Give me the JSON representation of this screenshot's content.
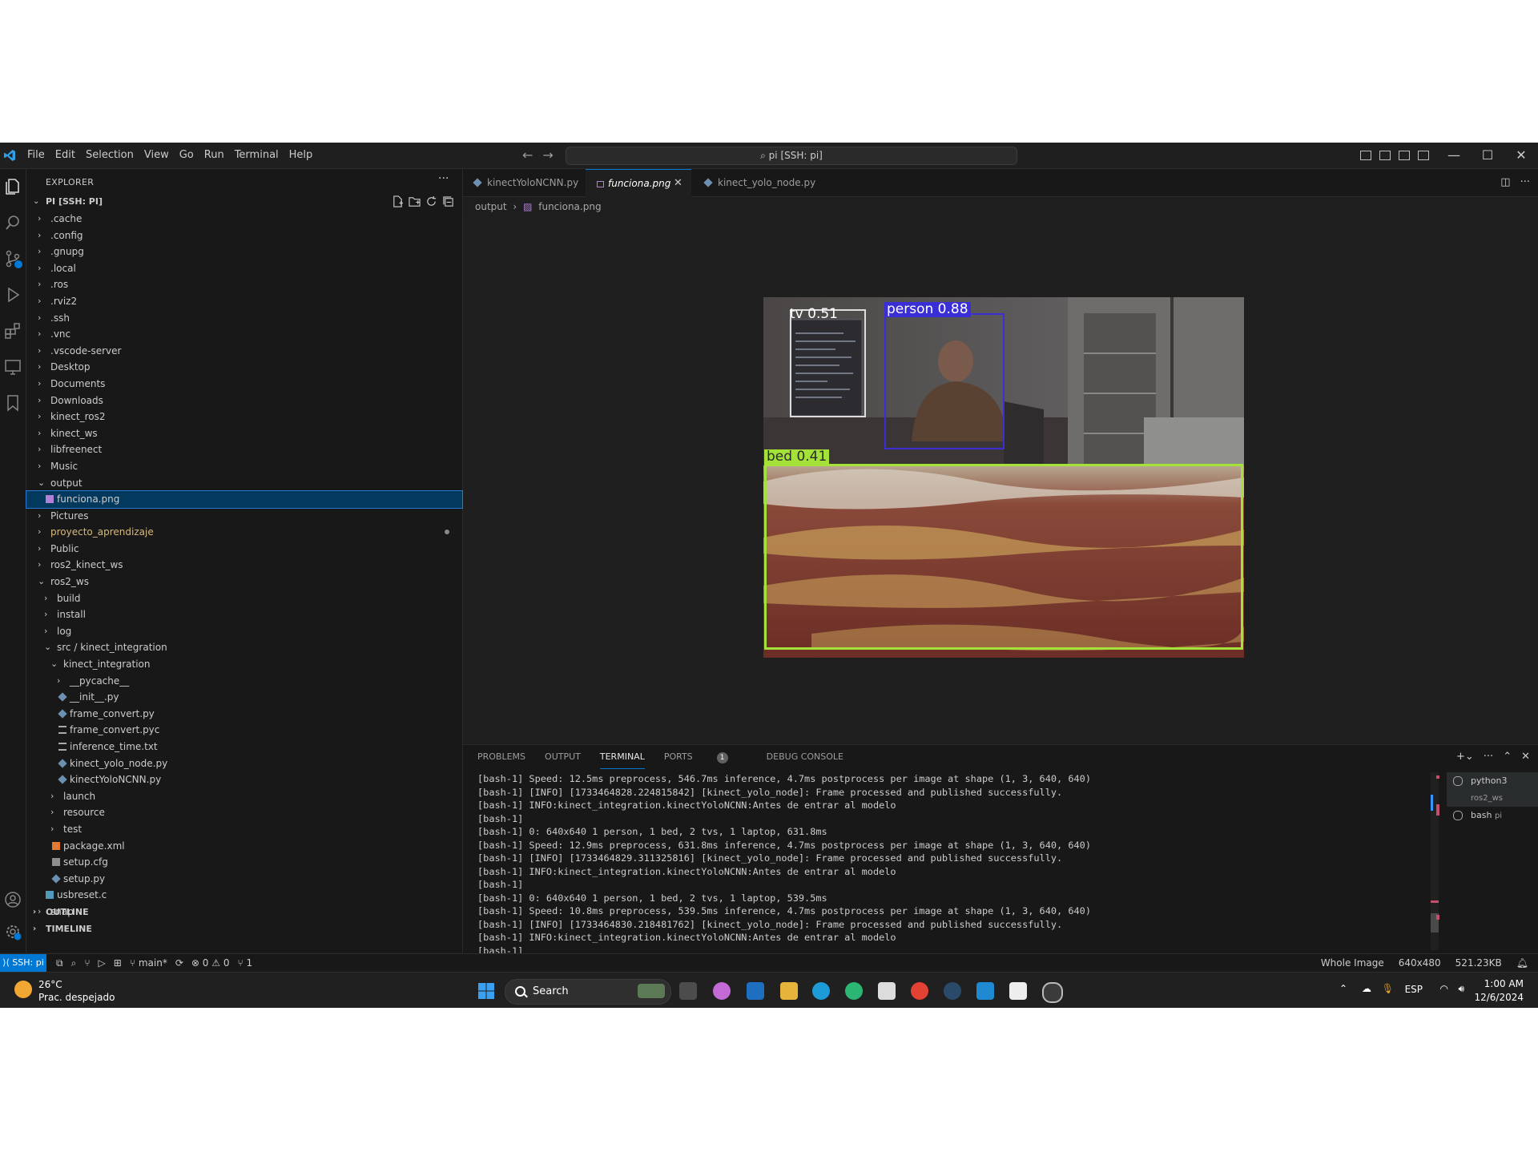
{
  "titlebar": {
    "menu": [
      "File",
      "Edit",
      "Selection",
      "View",
      "Go",
      "Run",
      "Terminal",
      "Help"
    ],
    "command_center": "pi [SSH: pi]",
    "back_icon": "arrow-left-icon",
    "forward_icon": "arrow-right-icon"
  },
  "sidebar": {
    "title": "EXPLORER",
    "root": "PI [SSH: PI]",
    "tree": [
      {
        "name": ".cache",
        "depth": 0,
        "kind": "folder",
        "open": false
      },
      {
        "name": ".config",
        "depth": 0,
        "kind": "folder",
        "open": false
      },
      {
        "name": ".gnupg",
        "depth": 0,
        "kind": "folder",
        "open": false
      },
      {
        "name": ".local",
        "depth": 0,
        "kind": "folder",
        "open": false
      },
      {
        "name": ".ros",
        "depth": 0,
        "kind": "folder",
        "open": false
      },
      {
        "name": ".rviz2",
        "depth": 0,
        "kind": "folder",
        "open": false
      },
      {
        "name": ".ssh",
        "depth": 0,
        "kind": "folder",
        "open": false
      },
      {
        "name": ".vnc",
        "depth": 0,
        "kind": "folder",
        "open": false
      },
      {
        "name": ".vscode-server",
        "depth": 0,
        "kind": "folder",
        "open": false
      },
      {
        "name": "Desktop",
        "depth": 0,
        "kind": "folder",
        "open": false
      },
      {
        "name": "Documents",
        "depth": 0,
        "kind": "folder",
        "open": false
      },
      {
        "name": "Downloads",
        "depth": 0,
        "kind": "folder",
        "open": false
      },
      {
        "name": "kinect_ros2",
        "depth": 0,
        "kind": "folder",
        "open": false
      },
      {
        "name": "kinect_ws",
        "depth": 0,
        "kind": "folder",
        "open": false
      },
      {
        "name": "libfreenect",
        "depth": 0,
        "kind": "folder",
        "open": false
      },
      {
        "name": "Music",
        "depth": 0,
        "kind": "folder",
        "open": false
      },
      {
        "name": "output",
        "depth": 0,
        "kind": "folder",
        "open": true
      },
      {
        "name": "funciona.png",
        "depth": 1,
        "kind": "png",
        "selected": true
      },
      {
        "name": "Pictures",
        "depth": 0,
        "kind": "folder",
        "open": false
      },
      {
        "name": "proyecto_aprendizaje",
        "depth": 0,
        "kind": "folder",
        "open": false,
        "modified": true
      },
      {
        "name": "Public",
        "depth": 0,
        "kind": "folder",
        "open": false
      },
      {
        "name": "ros2_kinect_ws",
        "depth": 0,
        "kind": "folder",
        "open": false
      },
      {
        "name": "ros2_ws",
        "depth": 0,
        "kind": "folder",
        "open": true
      },
      {
        "name": "build",
        "depth": 1,
        "kind": "folder",
        "open": false
      },
      {
        "name": "install",
        "depth": 1,
        "kind": "folder",
        "open": false
      },
      {
        "name": "log",
        "depth": 1,
        "kind": "folder",
        "open": false
      },
      {
        "name": "src / kinect_integration",
        "depth": 1,
        "kind": "folder",
        "open": true
      },
      {
        "name": "kinect_integration",
        "depth": 2,
        "kind": "folder",
        "open": true
      },
      {
        "name": "__pycache__",
        "depth": 3,
        "kind": "folder",
        "open": false
      },
      {
        "name": "__init__.py",
        "depth": 3,
        "kind": "py"
      },
      {
        "name": "frame_convert.py",
        "depth": 3,
        "kind": "py"
      },
      {
        "name": "frame_convert.pyc",
        "depth": 3,
        "kind": "txt"
      },
      {
        "name": "inference_time.txt",
        "depth": 3,
        "kind": "txt"
      },
      {
        "name": "kinect_yolo_node.py",
        "depth": 3,
        "kind": "py"
      },
      {
        "name": "kinectYoloNCNN.py",
        "depth": 3,
        "kind": "py"
      },
      {
        "name": "launch",
        "depth": 2,
        "kind": "folder",
        "open": false
      },
      {
        "name": "resource",
        "depth": 2,
        "kind": "folder",
        "open": false
      },
      {
        "name": "test",
        "depth": 2,
        "kind": "folder",
        "open": false
      },
      {
        "name": "package.xml",
        "depth": 2,
        "kind": "xml"
      },
      {
        "name": "setup.cfg",
        "depth": 2,
        "kind": "cfg"
      },
      {
        "name": "setup.py",
        "depth": 2,
        "kind": "py"
      },
      {
        "name": "usbreset.c",
        "depth": 1,
        "kind": "c"
      },
      {
        "name": "snap",
        "depth": 0,
        "kind": "folder",
        "open": false
      }
    ],
    "outline": "OUTLINE",
    "timeline": "TIMELINE"
  },
  "editor": {
    "tabs": [
      {
        "label": "kinectYoloNCNN.py",
        "active": false
      },
      {
        "label": "funciona.png",
        "active": true
      },
      {
        "label": "kinect_yolo_node.py",
        "active": false
      }
    ],
    "breadcrumb": [
      "output",
      "funciona.png"
    ],
    "detections": [
      {
        "label": "tv 0.51",
        "color": "#dcdcdc"
      },
      {
        "label": "person 0.88",
        "color": "#3a2fd6"
      },
      {
        "label": "bed 0.41",
        "color": "#a4e23a"
      }
    ]
  },
  "panel": {
    "tabs": [
      "PROBLEMS",
      "OUTPUT",
      "TERMINAL",
      "PORTS",
      "DEBUG CONSOLE"
    ],
    "ports_badge": "1",
    "terminal_lines": [
      "[bash-1] Speed: 12.5ms preprocess, 546.7ms inference, 4.7ms postprocess per image at shape (1, 3, 640, 640)",
      "[bash-1] [INFO] [1733464828.224815842] [kinect_yolo_node]: Frame processed and published successfully.",
      "[bash-1] INFO:kinect_integration.kinectYoloNCNN:Antes de entrar al modelo",
      "[bash-1]",
      "[bash-1] 0: 640x640 1 person, 1 bed, 2 tvs, 1 laptop, 631.8ms",
      "[bash-1] Speed: 12.9ms preprocess, 631.8ms inference, 4.7ms postprocess per image at shape (1, 3, 640, 640)",
      "[bash-1] [INFO] [1733464829.311325816] [kinect_yolo_node]: Frame processed and published successfully.",
      "[bash-1] INFO:kinect_integration.kinectYoloNCNN:Antes de entrar al modelo",
      "[bash-1]",
      "[bash-1] 0: 640x640 1 person, 1 bed, 2 tvs, 1 laptop, 539.5ms",
      "[bash-1] Speed: 10.8ms preprocess, 539.5ms inference, 4.7ms postprocess per image at shape (1, 3, 640, 640)",
      "[bash-1] [INFO] [1733464830.218481762] [kinect_yolo_node]: Frame processed and published successfully.",
      "[bash-1] INFO:kinect_integration.kinectYoloNCNN:Antes de entrar al modelo",
      "[bash-1]"
    ],
    "terminals": [
      {
        "name": "python3",
        "cwd": "ros2_ws"
      },
      {
        "name": "bash",
        "cwd": "pi"
      }
    ]
  },
  "statusbar": {
    "remote": "SSH: pi",
    "branch": "main*",
    "errors": "0",
    "warnings": "0",
    "ports": "1",
    "image_mode": "Whole Image",
    "dimensions": "640x480",
    "size": "521.23KB"
  },
  "taskbar": {
    "temperature": "26°C",
    "weather": "Prac. despejado",
    "search": "Search",
    "language": "ESP",
    "time": "1:00 AM",
    "date": "12/6/2024"
  }
}
